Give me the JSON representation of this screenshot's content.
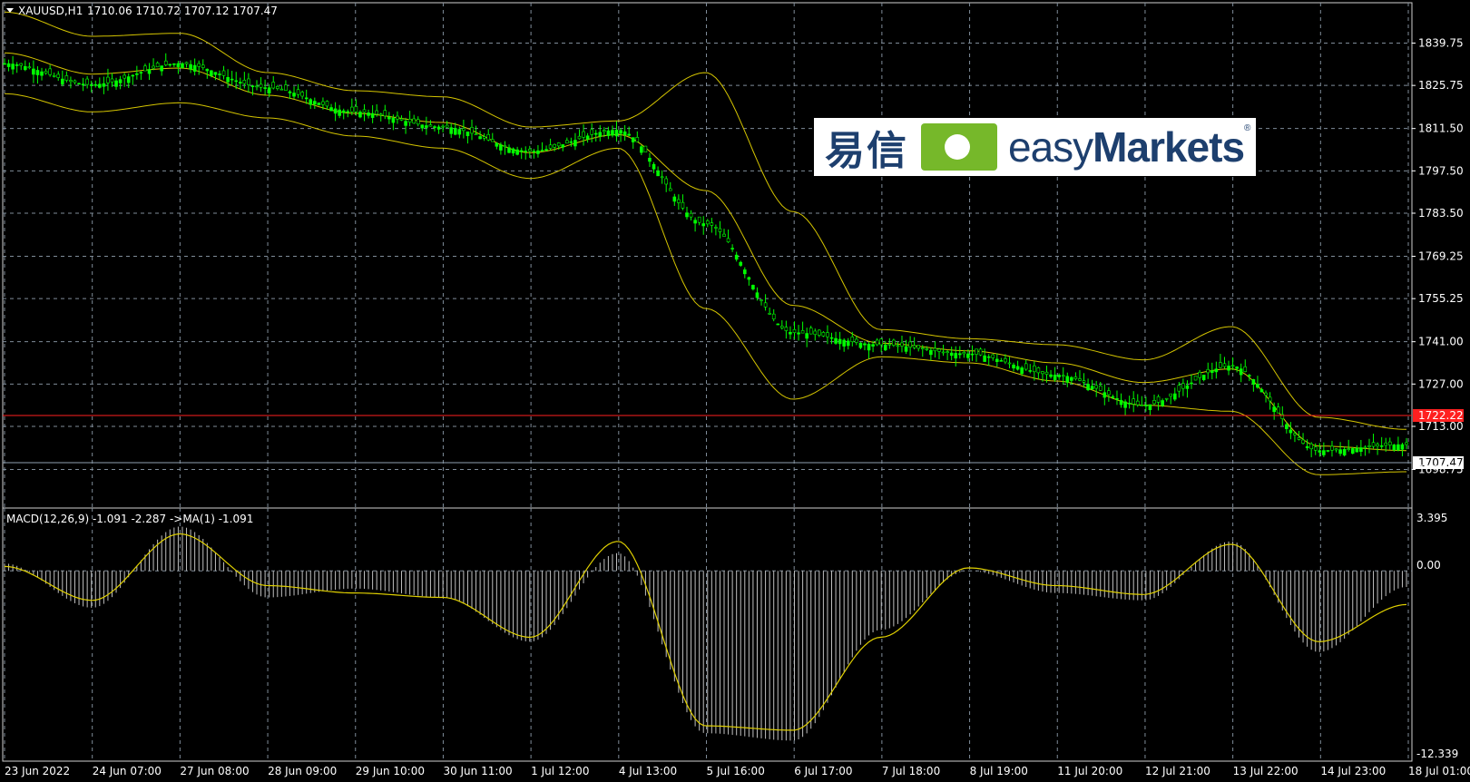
{
  "header": {
    "symbol_label": "XAUUSD,H1",
    "ohlc": "1710.06 1710.72 1707.12 1707.47"
  },
  "macd_label": "MACD(12,26,9) -1.091 -2.287  ->MA(1) -1.091",
  "logo": {
    "cn": "易信",
    "en_light": "easy",
    "en_bold": "Markets",
    "reg": "®"
  },
  "price_axis": [
    "1839.75",
    "1825.75",
    "1811.50",
    "1797.50",
    "1783.50",
    "1769.25",
    "1755.25",
    "1741.00",
    "1727.00",
    "1713.00",
    "1698.75"
  ],
  "price_tags": {
    "red_line": "1722.22",
    "current": "1707.47"
  },
  "macd_axis": {
    "top": "3.395",
    "zero": "0.00",
    "bottom": "-12.339"
  },
  "time_axis": [
    "23 Jun 2022",
    "24 Jun 07:00",
    "27 Jun 08:00",
    "28 Jun 09:00",
    "29 Jun 10:00",
    "30 Jun 11:00",
    "1 Jul 12:00",
    "4 Jul 13:00",
    "5 Jul 16:00",
    "6 Jul 17:00",
    "7 Jul 18:00",
    "8 Jul 19:00",
    "11 Jul 20:00",
    "12 Jul 21:00",
    "13 Jul 22:00",
    "14 Jul 23:00",
    "18 Jul 01:00"
  ],
  "colors": {
    "candle": "#00ff00",
    "bands": "#d4c400",
    "grid": "#7f8c99",
    "red_line": "#ff2020",
    "macd_hist": "#c0c0c0",
    "signal": "#e0d000"
  },
  "chart_data": [
    {
      "type": "line",
      "title": "XAUUSD,H1",
      "x": [
        "23 Jun 2022",
        "24 Jun 07:00",
        "27 Jun 08:00",
        "28 Jun 09:00",
        "29 Jun 10:00",
        "30 Jun 11:00",
        "1 Jul 12:00",
        "4 Jul 13:00",
        "5 Jul 16:00",
        "6 Jul 17:00",
        "7 Jul 18:00",
        "8 Jul 19:00",
        "11 Jul 20:00",
        "12 Jul 21:00",
        "13 Jul 22:00",
        "14 Jul 23:00",
        "18 Jul 01:00"
      ],
      "series": [
        {
          "values": [
            1833,
            1826,
            1833,
            1825,
            1817,
            1812,
            1804,
            1811,
            1780,
            1744,
            1740,
            1737,
            1730,
            1720,
            1733,
            1705,
            1707
          ]
        },
        {
          "values": [
            1850,
            1842,
            1843,
            1830,
            1824,
            1822,
            1812,
            1814,
            1830,
            1784,
            1745,
            1742,
            1740,
            1735,
            1746,
            1716,
            1712
          ]
        },
        {
          "values": [
            1823,
            1817,
            1820,
            1815,
            1809,
            1805,
            1795,
            1805,
            1752,
            1722,
            1736,
            1734,
            1728,
            1720,
            1718,
            1697,
            1698
          ]
        }
      ],
      "ylim": [
        1692,
        1848
      ],
      "horizontal_lines": [
        1722.22,
        1707.47
      ],
      "grid": true
    },
    {
      "type": "bar",
      "title": "MACD(12,26,9)",
      "x": [
        "23 Jun 2022",
        "24 Jun 07:00",
        "27 Jun 08:00",
        "28 Jun 09:00",
        "29 Jun 10:00",
        "30 Jun 11:00",
        "1 Jul 12:00",
        "4 Jul 13:00",
        "5 Jul 16:00",
        "6 Jul 17:00",
        "7 Jul 18:00",
        "8 Jul 19:00",
        "11 Jul 20:00",
        "12 Jul 21:00",
        "13 Jul 22:00",
        "14 Jul 23:00",
        "18 Jul 01:00"
      ],
      "series": [
        {
          "values": [
            0.5,
            -2.5,
            3.0,
            -1.8,
            -1.2,
            -1.8,
            -4.8,
            1.2,
            -11.0,
            -11.5,
            -4.0,
            0.0,
            -1.5,
            -2.0,
            2.0,
            -5.5,
            -1.091
          ]
        },
        {
          "values": [
            0.3,
            -2.0,
            2.5,
            -1.0,
            -1.5,
            -1.8,
            -4.5,
            2.0,
            -10.5,
            -10.8,
            -4.5,
            0.2,
            -1.0,
            -1.6,
            1.8,
            -4.8,
            -2.287
          ]
        }
      ],
      "ylim": [
        -12.339,
        3.395
      ],
      "grid": true
    }
  ]
}
